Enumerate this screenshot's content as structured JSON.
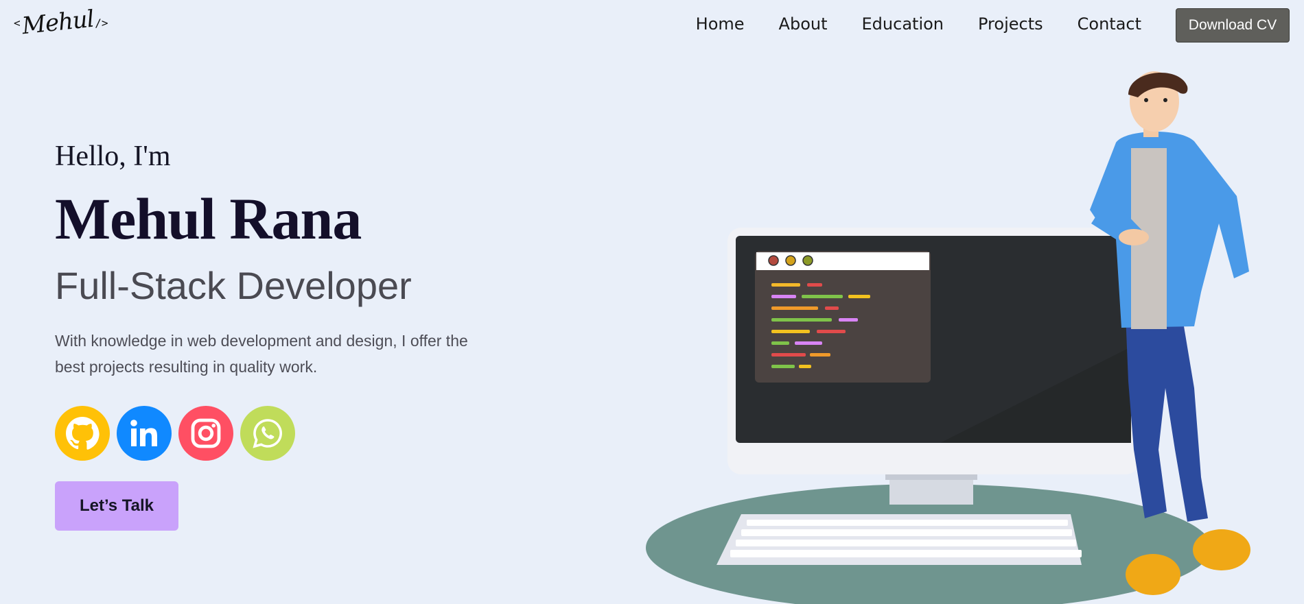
{
  "logo": {
    "open": "<",
    "name": "Mehul",
    "close": "/>"
  },
  "nav": {
    "items": [
      {
        "label": "Home"
      },
      {
        "label": "About"
      },
      {
        "label": "Education"
      },
      {
        "label": "Projects"
      },
      {
        "label": "Contact"
      }
    ],
    "cv_button": "Download CV"
  },
  "hero": {
    "greeting": "Hello, I'm",
    "name": "Mehul Rana",
    "role": "Full-Stack Developer",
    "description": "With knowledge in web development and design, I offer the best projects resulting in quality work.",
    "cta": "Let’s Talk"
  },
  "socials": [
    {
      "icon": "github-icon",
      "color": "#ffc107"
    },
    {
      "icon": "linkedin-icon",
      "color": "#1089ff"
    },
    {
      "icon": "instagram-icon",
      "color": "#ff4f63"
    },
    {
      "icon": "whatsapp-icon",
      "color": "#c0dc5a"
    }
  ],
  "colors": {
    "background": "#e9eff9",
    "accent": "#c9a2fb",
    "cv_button": "#5f5f5b"
  }
}
